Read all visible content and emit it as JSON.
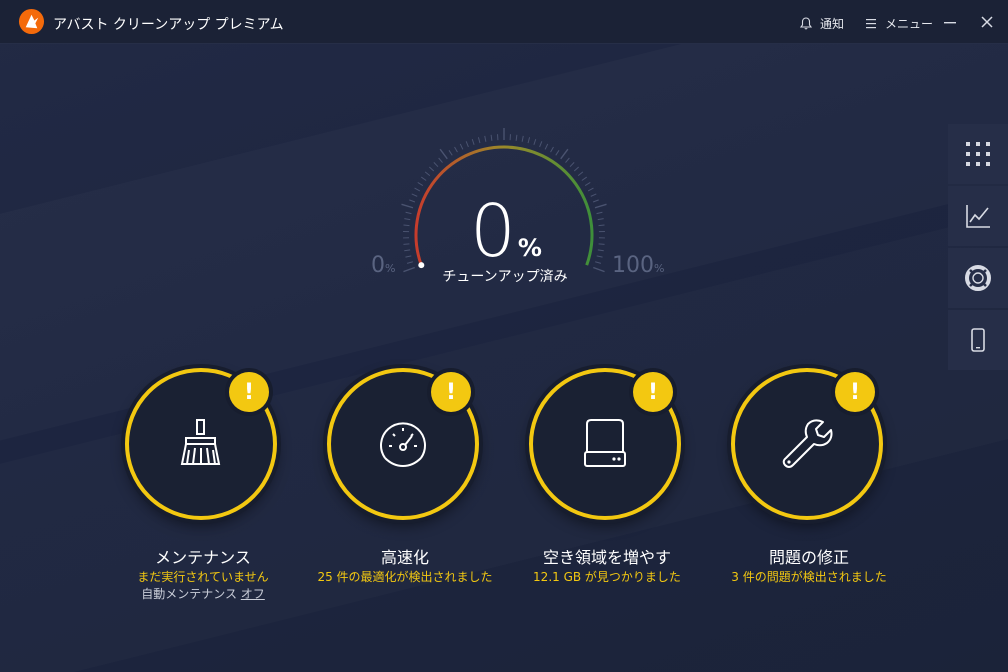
{
  "app": {
    "title": "アバスト クリーンアップ プレミアム"
  },
  "titlebar": {
    "notify_label": "通知",
    "menu_label": "メニュー"
  },
  "gauge": {
    "percent_value": "0",
    "percent_sign": "%",
    "caption": "チューンアップ済み",
    "min_value": "0",
    "min_unit": "%",
    "max_value": "100",
    "max_unit": "%",
    "progress": 0
  },
  "sidebar": {
    "items": [
      {
        "icon": "grid-icon"
      },
      {
        "icon": "chart-icon"
      },
      {
        "icon": "lifebuoy-icon"
      },
      {
        "icon": "phone-icon"
      }
    ]
  },
  "cards": [
    {
      "icon": "broom-icon",
      "title": "メンテナンス",
      "status": "まだ実行されていません",
      "sub_text": "自動メンテナンス ",
      "sub_link": "オフ",
      "badge": "!"
    },
    {
      "icon": "speedometer-icon",
      "title": "高速化",
      "status": "25 件の最適化が検出されました",
      "badge": "!"
    },
    {
      "icon": "hard-drive-icon",
      "title": "空き領域を増やす",
      "status": "12.1 GB が見つかりました",
      "badge": "!"
    },
    {
      "icon": "wrench-icon",
      "title": "問題の修正",
      "status": "3 件の問題が検出されました",
      "badge": "!"
    }
  ],
  "colors": {
    "accent_yellow": "#f3c811",
    "background": "#1f2740",
    "logo_orange": "#f46a0b"
  }
}
